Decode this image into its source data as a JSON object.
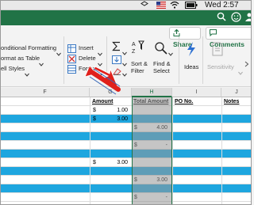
{
  "menubar": {
    "flag_icon": "us-flag-icon",
    "clock": "Wed 2:57 PM"
  },
  "titlebar": {
    "face_icon": "smiley-icon"
  },
  "ribbon": {
    "conditional_formatting": "onditional Formatting",
    "format_as_table": "ormat as Table",
    "cell_styles": "ell Styles",
    "insert": "Insert",
    "delete": "Delete",
    "format": "Format",
    "sort_filter": [
      "Sort &",
      "Filter"
    ],
    "find_select": [
      "Find &",
      "Select"
    ],
    "ideas": "Ideas",
    "sensitivity": "Sensitivity",
    "share": "Share",
    "comments": "Comments"
  },
  "sheet": {
    "columns": [
      "F",
      "G",
      "H",
      "I",
      "J"
    ],
    "headers": {
      "amount": "Amount",
      "total_amount": "Total Amount",
      "po_no": "PO No.",
      "notes": "Notes"
    },
    "rows": [
      {
        "amount_sym": "$",
        "amount": "1.00",
        "total_sym": "",
        "total": ""
      },
      {
        "amount_sym": "$",
        "amount": "3.00",
        "total_sym": "",
        "total": ""
      },
      {
        "amount_sym": "",
        "amount": "",
        "total_sym": "$",
        "total": "4.00"
      },
      {
        "amount_sym": "",
        "amount": "",
        "total_sym": "",
        "total": ""
      },
      {
        "amount_sym": "",
        "amount": "",
        "total_sym": "$",
        "total": "-"
      },
      {
        "amount_sym": "",
        "amount": "",
        "total_sym": "",
        "total": ""
      },
      {
        "amount_sym": "$",
        "amount": "3.00",
        "total_sym": "",
        "total": ""
      },
      {
        "amount_sym": "",
        "amount": "",
        "total_sym": "",
        "total": ""
      },
      {
        "amount_sym": "",
        "amount": "",
        "total_sym": "$",
        "total": "3.00"
      },
      {
        "amount_sym": "",
        "amount": "",
        "total_sym": "",
        "total": ""
      },
      {
        "amount_sym": "",
        "amount": "",
        "total_sym": "$",
        "total": "-"
      }
    ]
  },
  "colors": {
    "excel_green": "#217346",
    "row_blue": "#1ea6df",
    "arrow_red": "#e0201b"
  }
}
